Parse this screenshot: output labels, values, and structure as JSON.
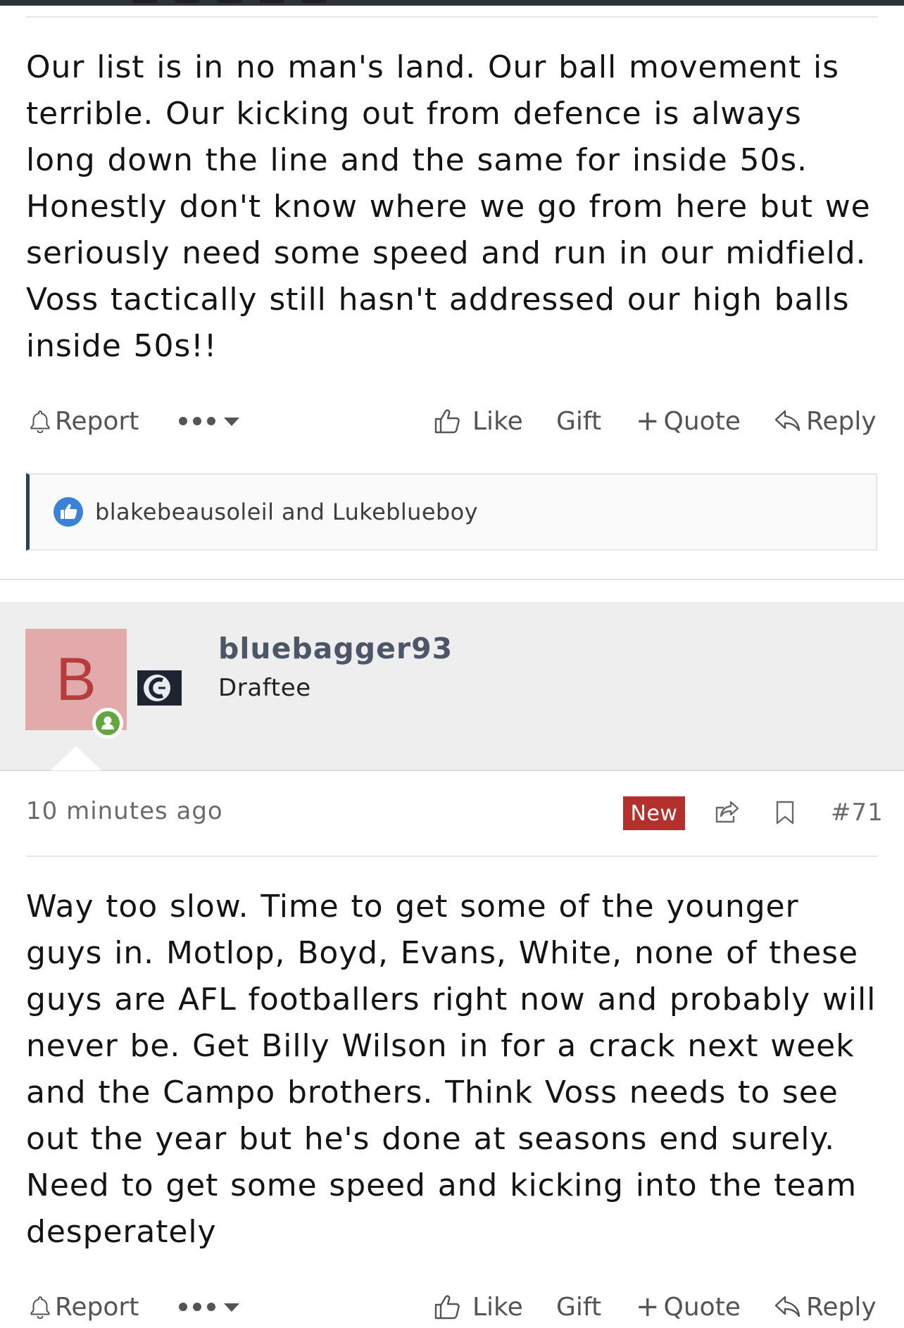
{
  "post_70": {
    "body": "Our list is in no man's land. Our ball movement is terrible. Our kicking out from defence is always long down the line and the same for inside 50s. Honestly don't know where we go from here but we seriously need some speed and run in our midfield. Voss tactically still hasn't addressed our high balls inside 50s!!",
    "actions": {
      "report": "Report",
      "like": "Like",
      "gift": "Gift",
      "quote": "Quote",
      "quote_prefix": "+",
      "reply": "Reply"
    },
    "reactions": "blakebeausoleil and Lukeblueboy"
  },
  "post_71": {
    "author": {
      "avatar_letter": "B",
      "username": "bluebagger93",
      "title": "Draftee"
    },
    "timestamp": "10 minutes ago",
    "badge": "New",
    "post_number": "#71",
    "body": "Way too slow. Time to get some of the younger guys in. Motlop, Boyd, Evans, White, none of these guys are AFL footballers right now and probably will never be. Get Billy Wilson in for a crack next week and the Campo brothers. Think Voss needs to see out the year but he's done at seasons end surely. Need to get some speed and kicking into the team desperately",
    "actions": {
      "report": "Report",
      "like": "Like",
      "gift": "Gift",
      "quote": "Quote",
      "quote_prefix": "+",
      "reply": "Reply"
    }
  },
  "icons": {
    "report": "bell-icon",
    "more": "more-dots-icon",
    "like": "thumbs-up-icon",
    "reply": "reply-arrow-icon",
    "share": "share-icon",
    "bookmark": "bookmark-icon",
    "online": "online-status-icon",
    "team": "team-logo-icon"
  },
  "colors": {
    "new_badge": "#b3302d",
    "avatar_bg": "#e2aaaa",
    "avatar_letter": "#b53d3d",
    "online": "#63a53f",
    "username": "#4c5666",
    "reaction_border": "#2b3f57",
    "like_badge": "#3b82d6"
  }
}
